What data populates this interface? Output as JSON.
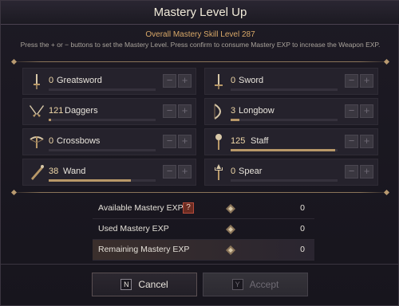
{
  "window": {
    "title": "Mastery Level Up"
  },
  "header": {
    "overall": "Overall Mastery Skill Level 287",
    "instructions": "Press the + or − buttons to set the Mastery Level. Press confirm to consume Mastery EXP to increase the Weapon EXP."
  },
  "weapons": [
    {
      "level": "0",
      "name": "Greatsword",
      "icon": "greatsword-icon",
      "progress": 0
    },
    {
      "level": "0",
      "name": "Sword",
      "icon": "sword-icon",
      "progress": 0
    },
    {
      "level": "121",
      "name": "Daggers",
      "icon": "daggers-icon",
      "progress": 0.02
    },
    {
      "level": "3",
      "name": "Longbow",
      "icon": "longbow-icon",
      "progress": 0.08
    },
    {
      "level": "0",
      "name": "Crossbows",
      "icon": "crossbows-icon",
      "progress": 0
    },
    {
      "level": "125",
      "name": "Staff",
      "icon": "staff-icon",
      "progress": 0.98
    },
    {
      "level": "38",
      "name": "Wand",
      "icon": "wand-icon",
      "progress": 0.77
    },
    {
      "level": "0",
      "name": "Spear",
      "icon": "spear-icon",
      "progress": 0
    }
  ],
  "buttons": {
    "minus": "−",
    "plus": "+"
  },
  "stats": {
    "available_label": "Available Mastery EXP",
    "available_value": "0",
    "info_glyph": "?",
    "used_label": "Used Mastery EXP",
    "used_value": "0",
    "remaining_label": "Remaining Mastery EXP",
    "remaining_value": "0"
  },
  "footer": {
    "cancel_key": "N",
    "cancel_label": "Cancel",
    "accept_key": "Y",
    "accept_label": "Accept"
  }
}
